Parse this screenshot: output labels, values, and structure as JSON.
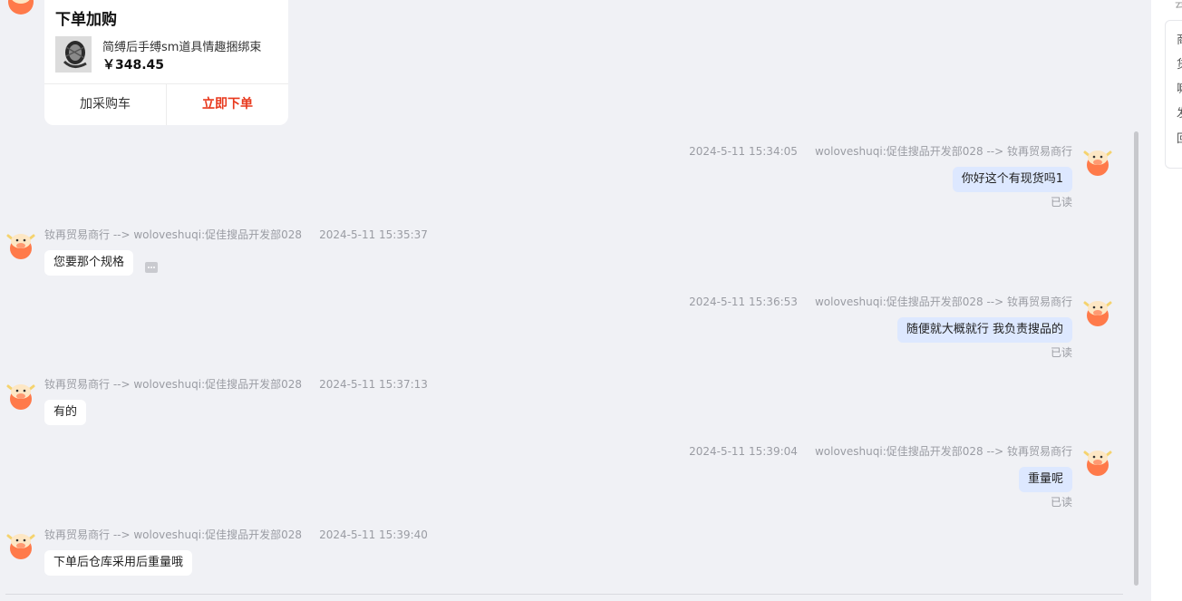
{
  "top_fragment": "云",
  "right_panel": {
    "lines": [
      "商",
      "货",
      "嘛",
      "发",
      "回"
    ]
  },
  "order_card": {
    "title": "下单加购",
    "product_name": "简缚后手缚sm道具情趣捆绑束",
    "price": "￥348.45",
    "add_cart_label": "加采购车",
    "order_now_label": "立即下单"
  },
  "messages": [
    {
      "direction": "out",
      "timestamp": "2024-5-11 15:34:05",
      "route": "woloveshuqi:促佳搜品开发部028 --> 钕再贸易商行",
      "text": "你好这个有现货吗1",
      "status": "已读"
    },
    {
      "direction": "in",
      "route": "钕再贸易商行 --> woloveshuqi:促佳搜品开发部028",
      "timestamp": "2024-5-11 15:35:37",
      "text": "您要那个规格"
    },
    {
      "direction": "out",
      "timestamp": "2024-5-11 15:36:53",
      "route": "woloveshuqi:促佳搜品开发部028 --> 钕再贸易商行",
      "text": "随便就大概就行 我负责搜品的",
      "status": "已读"
    },
    {
      "direction": "in",
      "route": "钕再贸易商行 --> woloveshuqi:促佳搜品开发部028",
      "timestamp": "2024-5-11 15:37:13",
      "text": "有的"
    },
    {
      "direction": "out",
      "timestamp": "2024-5-11 15:39:04",
      "route": "woloveshuqi:促佳搜品开发部028 --> 钕再贸易商行",
      "text": "重量呢",
      "status": "已读"
    },
    {
      "direction": "in",
      "route": "钕再贸易商行 --> woloveshuqi:促佳搜品开发部028",
      "timestamp": "2024-5-11 15:39:40",
      "text": "下单后仓库采用后重量哦"
    }
  ],
  "colors": {
    "background": "#f0f1f5",
    "outgoing_bubble": "#dde8ff",
    "incoming_bubble": "#ffffff",
    "accent_red": "#e8391d",
    "avatar_orange": "#ff7a4a"
  },
  "icons": {
    "avatar": "cow-avatar-icon",
    "more": "more-options-icon"
  }
}
